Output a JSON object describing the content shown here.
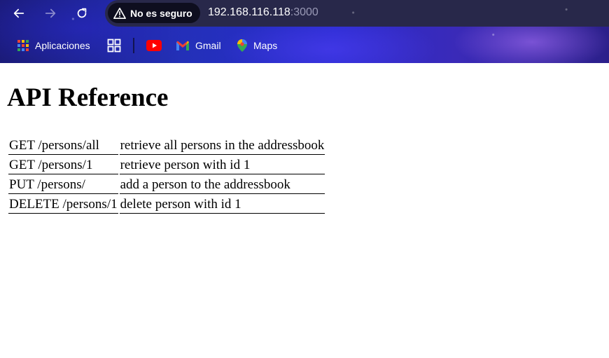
{
  "browser": {
    "security_label": "No es seguro",
    "url_host": "192.168.116.118",
    "url_port": ":3000",
    "icons": [
      "back-arrow-icon",
      "forward-arrow-icon",
      "reload-icon",
      "warning-triangle-icon"
    ],
    "bookmarks": [
      {
        "label": "Aplicaciones",
        "icon": "apps-grid-icon"
      },
      {
        "label": "",
        "icon": "tab-groups-icon"
      },
      {
        "label": "",
        "icon": "youtube-icon"
      },
      {
        "label": "Gmail",
        "icon": "gmail-icon"
      },
      {
        "label": "Maps",
        "icon": "maps-pin-icon"
      }
    ]
  },
  "page": {
    "title": "API Reference",
    "endpoints": [
      {
        "method_path": "GET /persons/all",
        "description": "retrieve all persons in the addressbook"
      },
      {
        "method_path": "GET /persons/1",
        "description": "retrieve person with id 1"
      },
      {
        "method_path": "PUT /persons/",
        "description": "add a person to the addressbook"
      },
      {
        "method_path": "DELETE /persons/1",
        "description": "delete person with id 1"
      }
    ]
  },
  "colors": {
    "chrome_dark": "#1b1b7a",
    "chrome_accent": "#2a2bd0",
    "omnibox": "#28284a",
    "security_chip": "#0e0e1f",
    "text": "#000000",
    "background": "#ffffff"
  }
}
